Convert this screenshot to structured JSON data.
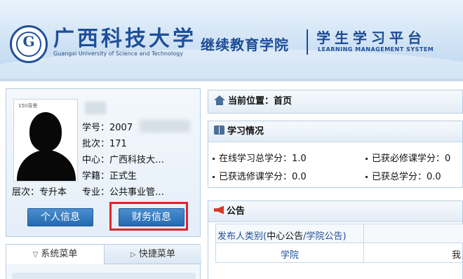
{
  "header": {
    "university_cn": "广西科技大学",
    "university_en": "Guangxi University of Science and Technology",
    "college": "继续教育学院",
    "platform_cn": "学生学习平台",
    "platform_en": "LEARNING MANAGEMENT SYSTEM",
    "brand_color": "#1d4c96"
  },
  "user": {
    "photo_caption": "150背景",
    "student_no_label": "学号：",
    "student_no_value": "2007",
    "batch_label": "批次：",
    "batch_value": "171",
    "center_label": "中心：",
    "center_value": "广西科技大…",
    "status_label": "学籍：",
    "status_value": "正式生",
    "level_label": "层次：",
    "level_value": "专升本",
    "major_label": "专业：",
    "major_value": "公共事业管…",
    "btn_personal": "个人信息",
    "btn_finance": "财务信息"
  },
  "menu": {
    "tab_system": "系统菜单",
    "tab_shortcut": "快捷菜单"
  },
  "location": {
    "label": "当前位置：",
    "value": "首页"
  },
  "study": {
    "title": "学习情况",
    "online_total": "在线学习总学分：1.0",
    "required_credit": "已获必修课学分：0",
    "elective_credit": "已获选修课学分：0.0",
    "total_credit": "已获总学分：0.0"
  },
  "notice": {
    "title": "公告",
    "publisher_label": "发布人类别",
    "paren_open": "(",
    "center_notice": "中心公告",
    "slash": "/",
    "college_notice": "学院公告",
    "paren_close": ")",
    "row1_col1": "学院",
    "row1_col2": "我"
  }
}
